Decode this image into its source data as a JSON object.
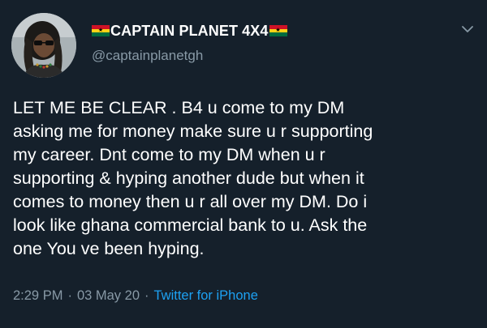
{
  "tweet": {
    "display_name": "CAPTAIN PLANET 4X4",
    "handle": "@captainplanetgh",
    "text": "LET ME BE CLEAR . B4 u come to my DM\nasking me for money make sure u r supporting\nmy career. Dnt come to my DM when u r\nsupporting & hyping another dude but when it\ncomes to money then u r all over my DM. Do i\nlook like ghana commercial bank to u. Ask the\none You ve been hyping.",
    "time": "2:29 PM",
    "separator": "·",
    "date": "03 May 20",
    "source": "Twitter for iPhone"
  },
  "icons": {
    "avatar": "profile-photo",
    "flag_left": "ghana-flag-icon",
    "flag_right": "ghana-flag-icon",
    "menu": "chevron-down-icon"
  },
  "colors": {
    "background": "#15202b",
    "text": "#ffffff",
    "muted": "#8899a6",
    "link": "#1da1f2"
  }
}
